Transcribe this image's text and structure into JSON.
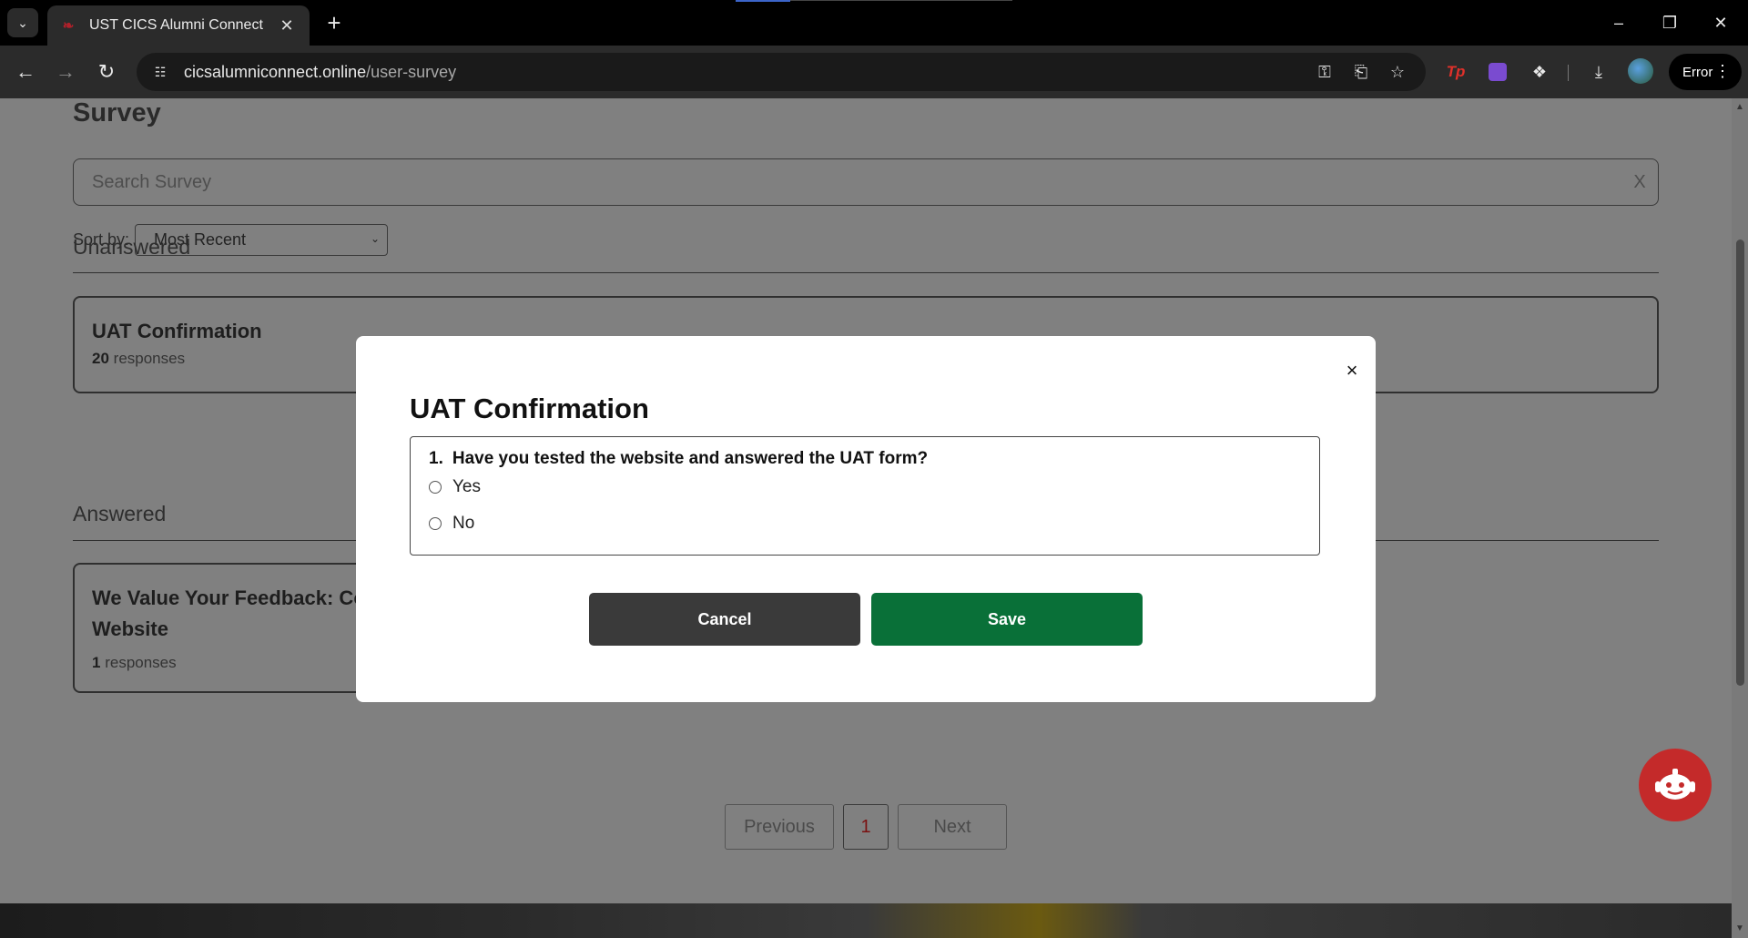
{
  "browser": {
    "tab_title": "UST CICS Alumni Connect",
    "url_host": "cicsalumniconnect.online",
    "url_path": "/user-survey",
    "profile_status": "Error",
    "icons": {
      "tab_dropdown": "chevron-down-icon",
      "new_tab": "plus-icon",
      "back": "arrow-left-icon",
      "forward": "arrow-right-icon",
      "reload": "reload-icon",
      "site_info": "tune-icon",
      "password": "key-icon",
      "install": "install-icon",
      "bookmark": "star-icon",
      "extensions": "puzzle-icon",
      "downloads": "download-icon"
    },
    "extensions": [
      "Tp"
    ]
  },
  "page": {
    "title": "Survey",
    "search": {
      "placeholder": "Search Survey",
      "clear_label": "X"
    },
    "sort": {
      "label": "Sort by:",
      "selected": "Most Recent"
    },
    "unanswered": {
      "heading": "Unanswered",
      "cards": [
        {
          "title": "UAT Confirmation",
          "count": "20",
          "count_suffix": "responses"
        }
      ]
    },
    "answered": {
      "heading": "Answered",
      "cards": [
        {
          "title_line1": "We Value Your Feedback: Co",
          "title_line2": "Website",
          "count": "1",
          "count_suffix": "responses"
        }
      ]
    },
    "pagination": {
      "previous": "Previous",
      "current": "1",
      "next": "Next"
    },
    "chatbot_icon": "robot-icon"
  },
  "modal": {
    "title": "UAT Confirmation",
    "close_label": "×",
    "question": {
      "number": "1.",
      "text": "Have you tested the website and answered the UAT form?",
      "options": [
        "Yes",
        "No"
      ]
    },
    "cancel_label": "Cancel",
    "save_label": "Save"
  },
  "colors": {
    "overlay_page": "#808080",
    "save_button": "#097038",
    "cancel_button": "#3a3a3a",
    "chatbot": "#c42a2a",
    "active_page": "#7a1010"
  }
}
